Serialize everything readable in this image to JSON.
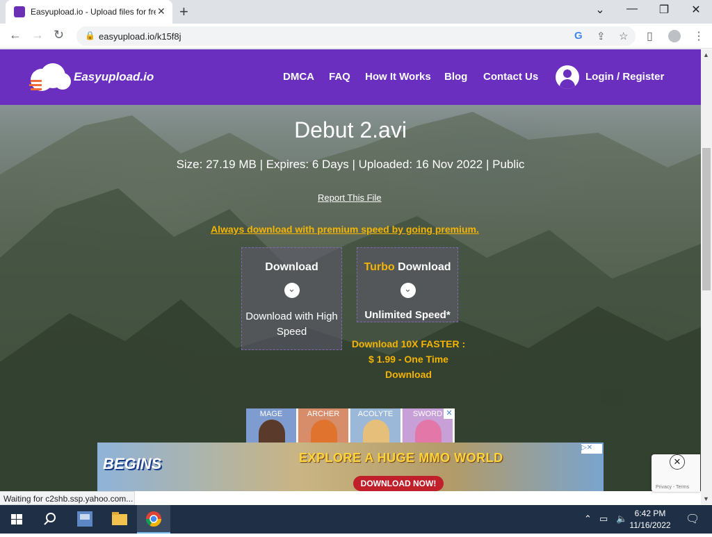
{
  "browser": {
    "tab_title": "Easyupload.io - Upload files for free",
    "tab_close": "✕",
    "new_tab": "+",
    "url": "easyupload.io/k15f8j",
    "window_minimize": "—",
    "window_restore": "❐",
    "window_close": "✕",
    "tab_search": "⌄"
  },
  "site": {
    "brand": "Easyupload.io",
    "nav": [
      "DMCA",
      "FAQ",
      "How It Works",
      "Blog",
      "Contact Us"
    ],
    "login": "Login / Register"
  },
  "file": {
    "name": "Debut 2.avi",
    "info": "Size: 27.19 MB | Expires: 6 Days | Uploaded: 16 Nov 2022 | Public",
    "report": "Report This File",
    "premium_link": "Always download with premium speed by going premium."
  },
  "download": {
    "free_title": "Download",
    "free_subtitle": "Download with High Speed",
    "turbo_word": "Turbo",
    "turbo_title": "Download",
    "turbo_subtitle": "Unlimited Speed*",
    "turbo_price": "Download 10X FASTER : $ 1.99 - One Time Download"
  },
  "ads": {
    "class_labels": [
      "MAGE",
      "ARCHER",
      "ACOLYTE",
      "SWORD"
    ],
    "banner_logo": "BEGINS",
    "banner_headline": "EXPLORE A HUGE MMO WORLD",
    "banner_cta": "DOWNLOAD NOW!",
    "recaptcha_label": "Privacy - Terms"
  },
  "status": "Waiting for c2shb.ssp.yahoo.com...",
  "taskbar": {
    "time": "6:42 PM",
    "date": "11/16/2022"
  },
  "colors": {
    "header_purple": "#6b2fbf",
    "accent_gold": "#f5b400"
  }
}
